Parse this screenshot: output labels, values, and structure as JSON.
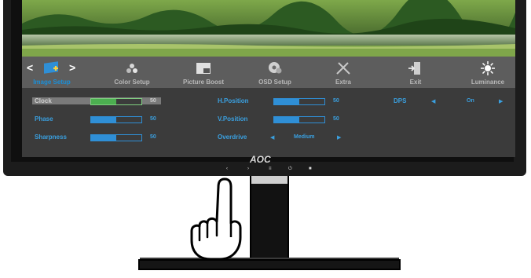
{
  "monitor": {
    "brand": "AOC",
    "buttons": [
      "‹",
      "›",
      "≡",
      "⏻",
      "■"
    ]
  },
  "menu": {
    "tabs": [
      {
        "label": "Image Setup",
        "icon": "image-setup-icon",
        "active": true
      },
      {
        "label": "Color Setup",
        "icon": "color-setup-icon",
        "active": false
      },
      {
        "label": "Picture Boost",
        "icon": "picture-boost-icon",
        "active": false
      },
      {
        "label": "OSD Setup",
        "icon": "osd-setup-icon",
        "active": false
      },
      {
        "label": "Extra",
        "icon": "extra-icon",
        "active": false
      },
      {
        "label": "Exit",
        "icon": "exit-icon",
        "active": false
      },
      {
        "label": "Luminance",
        "icon": "luminance-icon",
        "active": false
      }
    ],
    "nav_left": "<",
    "nav_right": ">"
  },
  "settings": {
    "clock": {
      "label": "Clock",
      "value": "50",
      "level": 0.5,
      "selected": true
    },
    "phase": {
      "label": "Phase",
      "value": "50",
      "level": 0.5
    },
    "sharpness": {
      "label": "Sharpness",
      "value": "50",
      "level": 0.5
    },
    "h_position": {
      "label": "H.Position",
      "value": "50",
      "level": 0.5
    },
    "v_position": {
      "label": "V.Position",
      "value": "50",
      "level": 0.5
    },
    "overdrive": {
      "label": "Overdrive",
      "value": "Medium"
    },
    "dps": {
      "label": "DPS",
      "value": "On"
    }
  },
  "colors": {
    "accent": "#2f8fd6",
    "selected_fill": "#4caf50",
    "menubar": "#5d5d5d",
    "panel": "#3b3b3b"
  }
}
